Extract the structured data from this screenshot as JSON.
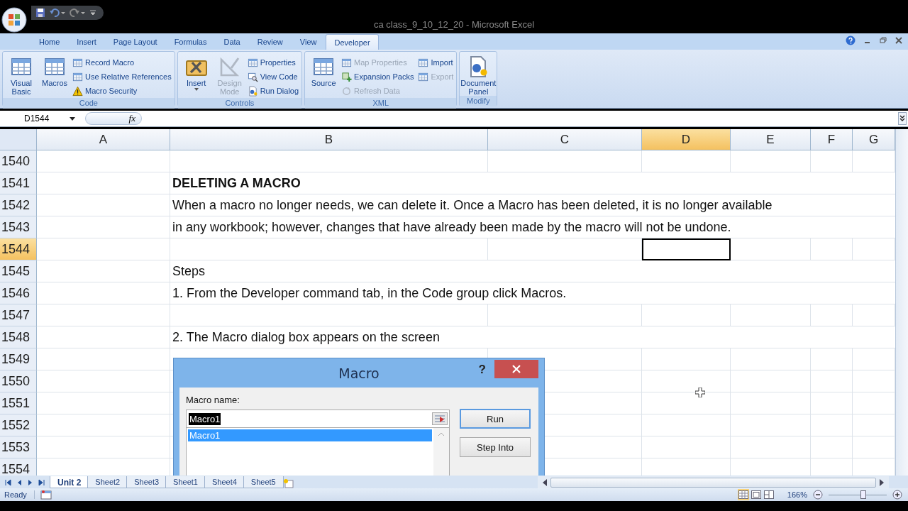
{
  "window": {
    "title": "ca class_9_10_12_20 - Microsoft Excel"
  },
  "ribbon_tabs": [
    {
      "label": "Home",
      "selected": false
    },
    {
      "label": "Insert",
      "selected": false
    },
    {
      "label": "Page Layout",
      "selected": false
    },
    {
      "label": "Formulas",
      "selected": false
    },
    {
      "label": "Data",
      "selected": false
    },
    {
      "label": "Review",
      "selected": false
    },
    {
      "label": "View",
      "selected": false
    },
    {
      "label": "Developer",
      "selected": true
    }
  ],
  "ribbon_groups": [
    {
      "label": "Code",
      "large": [
        {
          "label": "Visual Basic",
          "disabled": false,
          "dropdown": false
        },
        {
          "label": "Macros",
          "disabled": false,
          "dropdown": false
        }
      ],
      "small": [
        {
          "label": "Record Macro",
          "disabled": false
        },
        {
          "label": "Use Relative References",
          "disabled": false
        },
        {
          "label": "Macro Security",
          "disabled": false
        }
      ]
    },
    {
      "label": "Controls",
      "large": [
        {
          "label": "Insert",
          "disabled": false,
          "dropdown": true
        },
        {
          "label": "Design Mode",
          "disabled": true,
          "dropdown": false
        }
      ],
      "small": [
        {
          "label": "Properties",
          "disabled": false
        },
        {
          "label": "View Code",
          "disabled": false
        },
        {
          "label": "Run Dialog",
          "disabled": false
        }
      ]
    },
    {
      "label": "XML",
      "large": [
        {
          "label": "Source",
          "disabled": false,
          "dropdown": false
        }
      ],
      "small": [
        {
          "label": "Map Properties",
          "disabled": true
        },
        {
          "label": "Expansion Packs",
          "disabled": false
        },
        {
          "label": "Refresh Data",
          "disabled": true
        },
        {
          "label": "Import",
          "disabled": false
        },
        {
          "label": "Export",
          "disabled": true
        }
      ]
    },
    {
      "label": "Modify",
      "large": [
        {
          "label": "Document Panel",
          "disabled": false,
          "dropdown": false
        }
      ]
    }
  ],
  "formula_bar": {
    "name_box": "D1544",
    "function_label": "fx"
  },
  "columns": [
    {
      "label": "A",
      "selected": false
    },
    {
      "label": "B",
      "selected": false
    },
    {
      "label": "C",
      "selected": false
    },
    {
      "label": "D",
      "selected": true
    },
    {
      "label": "E",
      "selected": false
    },
    {
      "label": "F",
      "selected": false
    },
    {
      "label": "G",
      "selected": false
    }
  ],
  "rows": [
    {
      "number": "1540",
      "selected": false
    },
    {
      "number": "1541",
      "selected": false,
      "text": "DELETING A MACRO",
      "kind": "heading"
    },
    {
      "number": "1542",
      "selected": false,
      "text": "When a macro no longer needs, we can delete it. Once a Macro has been deleted, it is no longer available",
      "kind": "body"
    },
    {
      "number": "1543",
      "selected": false,
      "text": "in any workbook; however, changes that have already been made by the macro will not be undone.",
      "kind": "body"
    },
    {
      "number": "1544",
      "selected": true
    },
    {
      "number": "1545",
      "selected": false,
      "text": "Steps",
      "kind": "body"
    },
    {
      "number": "1546",
      "selected": false,
      "text": "1. From the Developer command tab, in the Code group click Macros.",
      "kind": "body"
    },
    {
      "number": "1547",
      "selected": false
    },
    {
      "number": "1548",
      "selected": false,
      "text": "2. The Macro dialog box appears on the screen",
      "kind": "body"
    },
    {
      "number": "1549",
      "selected": false
    },
    {
      "number": "1550",
      "selected": false
    },
    {
      "number": "1551",
      "selected": false
    },
    {
      "number": "1552",
      "selected": false
    },
    {
      "number": "1553",
      "selected": false
    },
    {
      "number": "1554",
      "selected": false
    }
  ],
  "dialog": {
    "title": "Macro",
    "help": "?",
    "name_label": "Macro name:",
    "name_value": "Macro1",
    "list": [
      {
        "label": "Macro1",
        "selected": true
      }
    ],
    "buttons": [
      {
        "label": "Run",
        "selected": true
      },
      {
        "label": "Step Into",
        "selected": false
      }
    ]
  },
  "sheet_tabs": [
    {
      "label": "Unit 2",
      "selected": true
    },
    {
      "label": "Sheet2",
      "selected": false
    },
    {
      "label": "Sheet3",
      "selected": false
    },
    {
      "label": "Sheet1",
      "selected": false
    },
    {
      "label": "Sheet4",
      "selected": false
    },
    {
      "label": "Sheet5",
      "selected": false
    }
  ],
  "status_bar": {
    "status": "Ready",
    "views": [
      {
        "selected": true
      },
      {
        "selected": false
      },
      {
        "selected": false
      }
    ],
    "zoom": "166%",
    "zoom_slider": {
      "level": 0.6
    }
  }
}
